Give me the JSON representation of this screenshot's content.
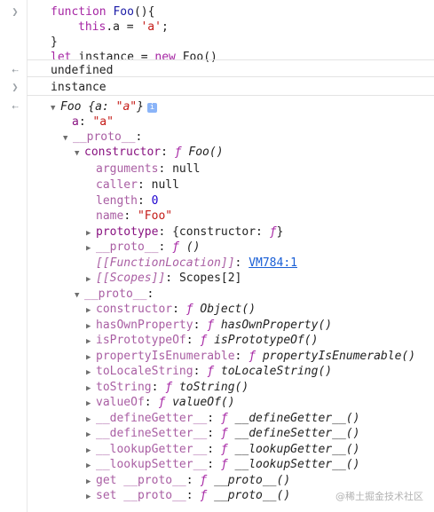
{
  "console": {
    "prompt_glyph": "❯",
    "result_glyph": "⇠",
    "input1": {
      "l1_kw": "function",
      "l1_name": "Foo",
      "l1_tail": "(){",
      "l2_this": "this",
      "l2_mid": ".a = ",
      "l2_str": "'a'",
      "l2_tail": ";",
      "l3": "}",
      "l4_kw": "let",
      "l4_var": " instance = ",
      "l4_new": "new",
      "l4_tail": " Foo()"
    },
    "output1": "undefined",
    "input2": "instance",
    "tree": {
      "root_name": "Foo",
      "root_preview": " {a: ",
      "root_val": "\"a\"",
      "root_close": "}",
      "info_glyph": "i",
      "a_key": "a",
      "a_val": "\"a\"",
      "proto_key": "__proto__",
      "ctor_key": "constructor",
      "ctor_f": "ƒ",
      "ctor_sig": "Foo()",
      "arguments_key": "arguments",
      "arguments_val": "null",
      "caller_key": "caller",
      "caller_val": "null",
      "length_key": "length",
      "length_val": "0",
      "name_key": "name",
      "name_val": "\"Foo\"",
      "prototype_key": "prototype",
      "prototype_val": "{constructor: ",
      "prototype_f": "ƒ",
      "prototype_close": "}",
      "inner_proto_key": "__proto__",
      "inner_proto_f": "ƒ",
      "inner_proto_sig": "()",
      "fnloc_key": "[[FunctionLocation]]",
      "fnloc_link": "VM784:1",
      "scopes_key": "[[Scopes]]",
      "scopes_val": "Scopes[2]",
      "object_proto_key": "__proto__",
      "methods": [
        {
          "key": "constructor",
          "f": "ƒ",
          "sig": "Object()"
        },
        {
          "key": "hasOwnProperty",
          "f": "ƒ",
          "sig": "hasOwnProperty()"
        },
        {
          "key": "isPrototypeOf",
          "f": "ƒ",
          "sig": "isPrototypeOf()"
        },
        {
          "key": "propertyIsEnumerable",
          "f": "ƒ",
          "sig": "propertyIsEnumerable()"
        },
        {
          "key": "toLocaleString",
          "f": "ƒ",
          "sig": "toLocaleString()"
        },
        {
          "key": "toString",
          "f": "ƒ",
          "sig": "toString()"
        },
        {
          "key": "valueOf",
          "f": "ƒ",
          "sig": "valueOf()"
        },
        {
          "key": "__defineGetter__",
          "f": "ƒ",
          "sig": "__defineGetter__()"
        },
        {
          "key": "__defineSetter__",
          "f": "ƒ",
          "sig": "__defineSetter__()"
        },
        {
          "key": "__lookupGetter__",
          "f": "ƒ",
          "sig": "__lookupGetter__()"
        },
        {
          "key": "__lookupSetter__",
          "f": "ƒ",
          "sig": "__lookupSetter__()"
        },
        {
          "key": "get __proto__",
          "f": "ƒ",
          "sig": "__proto__()"
        },
        {
          "key": "set __proto__",
          "f": "ƒ",
          "sig": "__proto__()"
        }
      ]
    },
    "expand_glyph": "▼",
    "collapse_glyph": "▶"
  },
  "watermark": "@稀土掘金技术社区",
  "colors": {
    "keyword": "#a626a4",
    "string": "#c41a16",
    "property": "#881280",
    "number": "#1c00cf",
    "link": "#1a5fd6"
  }
}
